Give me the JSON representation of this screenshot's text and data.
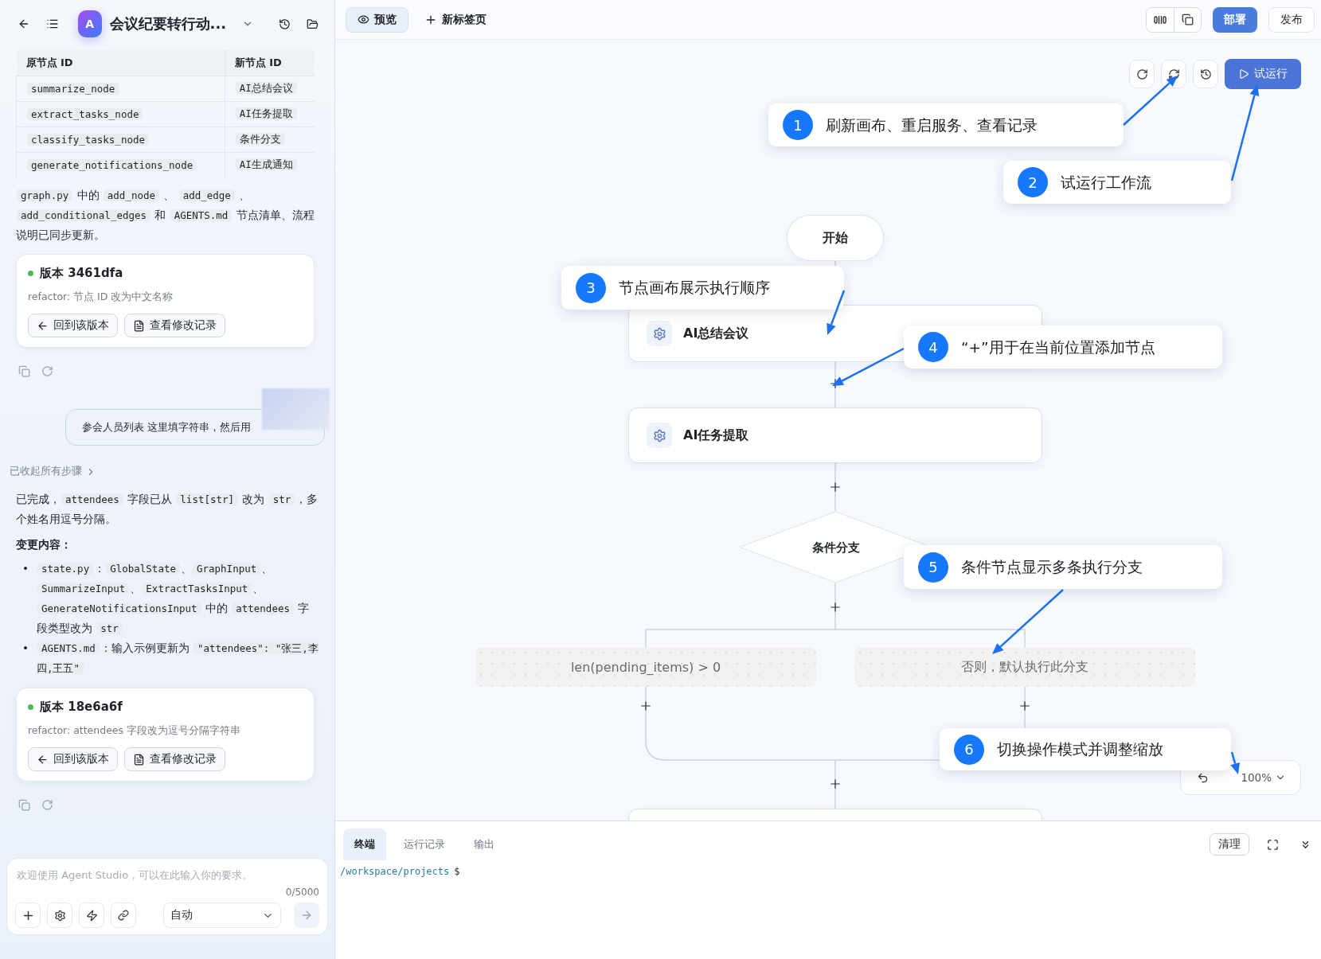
{
  "sidebar": {
    "header": {
      "app_initial": "A",
      "title": "会议纪要转行动..."
    },
    "chat": [
      {
        "kind": "table",
        "columns": [
          "原节点 ID",
          "新节点 ID"
        ],
        "rows": [
          [
            "summarize_node",
            "AI总结会议"
          ],
          [
            "extract_tasks_node",
            "AI任务提取"
          ],
          [
            "classify_tasks_node",
            "条件分支"
          ],
          [
            "generate_notifications_node",
            "AI生成通知"
          ]
        ]
      },
      {
        "kind": "paragraph",
        "segments": [
          {
            "kind": "code",
            "text": "graph.py"
          },
          {
            "kind": "text",
            "text": " 中的 "
          },
          {
            "kind": "code",
            "text": "add_node"
          },
          {
            "kind": "text",
            "text": " 、 "
          },
          {
            "kind": "code",
            "text": "add_edge"
          },
          {
            "kind": "text",
            "text": " 、 "
          },
          {
            "kind": "code",
            "text": "add_conditional_edges"
          },
          {
            "kind": "text",
            "text": " 和 "
          },
          {
            "kind": "code",
            "text": "AGENTS.md"
          },
          {
            "kind": "text",
            "text": " 节点清单、流程说明已同步更新。"
          }
        ]
      },
      {
        "kind": "version_card",
        "title": "版本 3461dfa",
        "message": "refactor: 节点 ID 改为中文名称",
        "actions": [
          "回到该版本",
          "查看修改记录"
        ]
      },
      {
        "kind": "message_actions"
      },
      {
        "kind": "user_message",
        "text": "参会人员列表 这里填字符串，然后用"
      },
      {
        "kind": "collapsed_steps",
        "text": "已收起所有步骤"
      },
      {
        "kind": "paragraph",
        "segments": [
          {
            "kind": "text",
            "text": "已完成，"
          },
          {
            "kind": "code",
            "text": "attendees"
          },
          {
            "kind": "text",
            "text": " 字段已从 "
          },
          {
            "kind": "code",
            "text": "list[str]"
          },
          {
            "kind": "text",
            "text": " 改为 "
          },
          {
            "kind": "code",
            "text": "str"
          },
          {
            "kind": "text",
            "text": "，多个姓名用逗号分隔。"
          }
        ]
      },
      {
        "kind": "heading",
        "text": "变更内容："
      },
      {
        "kind": "bullets",
        "items": [
          {
            "marker": "•",
            "segments": [
              {
                "kind": "code",
                "text": "state.py"
              },
              {
                "kind": "text",
                "text": "："
              },
              {
                "kind": "code",
                "text": "GlobalState"
              },
              {
                "kind": "text",
                "text": "、"
              },
              {
                "kind": "code",
                "text": "GraphInput"
              },
              {
                "kind": "text",
                "text": "、"
              },
              {
                "kind": "code",
                "text": "SummarizeInput"
              },
              {
                "kind": "text",
                "text": "、"
              },
              {
                "kind": "code",
                "text": "ExtractTasksInput"
              },
              {
                "kind": "text",
                "text": "、"
              },
              {
                "kind": "code",
                "text": "GenerateNotificationsInput"
              },
              {
                "kind": "text",
                "text": " 中的 "
              },
              {
                "kind": "code",
                "text": "attendees"
              },
              {
                "kind": "text",
                "text": " 字段类型改为 "
              },
              {
                "kind": "code",
                "text": "str"
              }
            ]
          },
          {
            "marker": "•",
            "segments": [
              {
                "kind": "code",
                "text": "AGENTS.md"
              },
              {
                "kind": "text",
                "text": "：输入示例更新为 "
              },
              {
                "kind": "code",
                "text": "\"attendees\": \"张三,李四,王五\""
              }
            ]
          }
        ]
      },
      {
        "kind": "version_card",
        "title": "版本 18e6a6f",
        "message": "refactor: attendees 字段改为逗号分隔字符串",
        "actions": [
          "回到该版本",
          "查看修改记录"
        ]
      },
      {
        "kind": "message_actions"
      }
    ],
    "composer": {
      "placeholder": "欢迎使用 Agent Studio，可以在此输入你的要求。",
      "counter": "0/5000",
      "mode": "自动"
    }
  },
  "topbar": {
    "tabs": [
      {
        "label": "预览",
        "selected": true
      }
    ],
    "new_tab": "新标签页",
    "deploy": "部署",
    "publish": "发布"
  },
  "canvas": {
    "run_label": "试运行",
    "nodes": [
      {
        "kind": "start",
        "label": "开始"
      },
      {
        "kind": "task",
        "label": "AI总结会议"
      },
      {
        "kind": "task",
        "label": "AI任务提取"
      },
      {
        "kind": "condition",
        "label": "条件分支"
      },
      {
        "kind": "branch",
        "label": "len(pending_items) > 0"
      },
      {
        "kind": "branch",
        "label": "否则，默认执行此分支"
      }
    ],
    "callouts": [
      {
        "number": "1",
        "text": "刷新画布、重启服务、查看记录"
      },
      {
        "number": "2",
        "text": "试运行工作流"
      },
      {
        "number": "3",
        "text": "节点画布展示执行顺序"
      },
      {
        "number": "4",
        "text": "“+”用于在当前位置添加节点"
      },
      {
        "number": "5",
        "text": "条件节点显示多条执行分支"
      },
      {
        "number": "6",
        "text": "切换操作模式并调整缩放"
      }
    ],
    "zoom": "100%"
  },
  "console": {
    "tabs": [
      {
        "label": "终端",
        "selected": true
      },
      {
        "label": "运行记录",
        "selected": false
      },
      {
        "label": "输出",
        "selected": false
      }
    ],
    "clear": "清理",
    "path": "/workspace/projects",
    "symbol": "$"
  }
}
